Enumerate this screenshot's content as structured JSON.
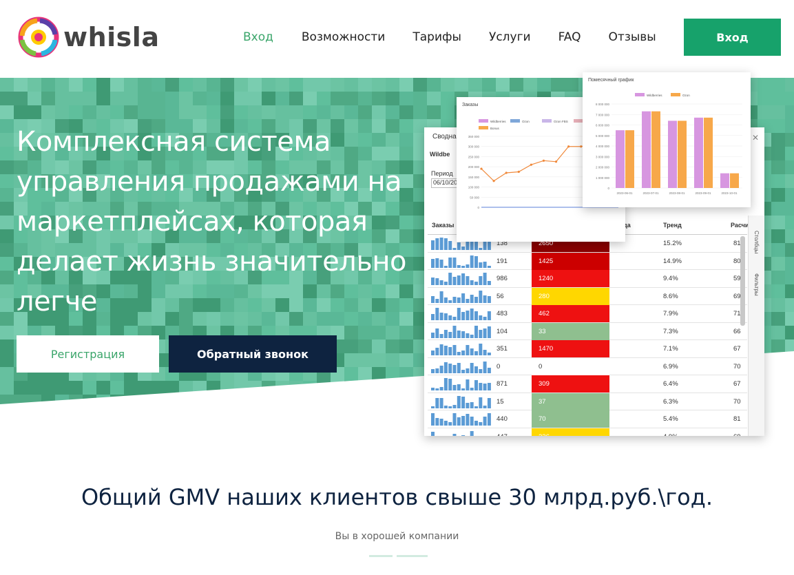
{
  "brand": {
    "name": "whisla",
    "accent": "#17a26b",
    "dark": "#0e2340"
  },
  "nav": {
    "items": [
      {
        "label": "Вход",
        "active": true
      },
      {
        "label": "Возможности"
      },
      {
        "label": "Тарифы"
      },
      {
        "label": "Услуги"
      },
      {
        "label": "FAQ"
      },
      {
        "label": "Отзывы"
      }
    ],
    "login_button": "Вход"
  },
  "hero": {
    "title": "Комплексная система управления продажами на маркетплейсах, которая делает жизнь значительно легче",
    "register_button": "Регистрация",
    "callback_button": "Обратный звонок"
  },
  "mockup": {
    "window_title": "Сводна",
    "tab": "Wildbe",
    "period_label": "Период",
    "period_value": "06/10/202",
    "columns": {
      "orders": "Заказы",
      "trend": "Тренд",
      "calc": "Расчита",
      "partial": "да"
    },
    "side_labels": {
      "columns": "Столбцы",
      "filters": "Фильтры"
    },
    "rows": [
      {
        "orders": "138",
        "heat": "2650",
        "heat_color": "#8b0000",
        "trend": "15.2%",
        "calc": "81"
      },
      {
        "orders": "191",
        "heat": "1425",
        "heat_color": "#cc0000",
        "trend": "14.9%",
        "calc": "80"
      },
      {
        "orders": "986",
        "heat": "1240",
        "heat_color": "#ee1111",
        "trend": "9.4%",
        "calc": "59"
      },
      {
        "orders": "56",
        "heat": "280",
        "heat_color": "#ffd700",
        "trend": "8.6%",
        "calc": "69"
      },
      {
        "orders": "483",
        "heat": "462",
        "heat_color": "#ee1111",
        "trend": "7.9%",
        "calc": "71"
      },
      {
        "orders": "104",
        "heat": "33",
        "heat_color": "#8fbf8f",
        "trend": "7.3%",
        "calc": "66"
      },
      {
        "orders": "351",
        "heat": "1470",
        "heat_color": "#ee1111",
        "trend": "7.1%",
        "calc": "67"
      },
      {
        "orders": "0",
        "heat": "0",
        "heat_color": "#ffffff",
        "trend": "6.9%",
        "calc": "70"
      },
      {
        "orders": "871",
        "heat": "309",
        "heat_color": "#ee1111",
        "trend": "6.4%",
        "calc": "67"
      },
      {
        "orders": "15",
        "heat": "37",
        "heat_color": "#8fbf8f",
        "trend": "6.3%",
        "calc": "70"
      },
      {
        "orders": "440",
        "heat": "70",
        "heat_color": "#8fbf8f",
        "trend": "5.4%",
        "calc": "81"
      },
      {
        "orders": "447",
        "heat": "226",
        "heat_color": "#ffd700",
        "trend": "4.9%",
        "calc": "69"
      }
    ],
    "line_chart": {
      "title": "Заказы",
      "legend": [
        "Wildberries",
        "Ozon",
        "Ozon FBS",
        "Yandex / SB",
        "Bonus"
      ],
      "y_ticks": [
        "350 000",
        "300 000",
        "250 000",
        "200 000",
        "150 000",
        "100 000",
        "50 000",
        "0"
      ],
      "values": [
        190000,
        130000,
        170000,
        175000,
        210000,
        230000,
        225000,
        300000,
        300000,
        310000,
        260000,
        230000
      ]
    },
    "bar_chart": {
      "title": "Помесячный график",
      "legend": [
        "Wildberries",
        "Ozon"
      ],
      "y_ticks": [
        "8 000 000",
        "7 000 000",
        "6 000 000",
        "5 000 000",
        "4 000 000",
        "3 000 000",
        "2 000 000",
        "1 000 000",
        "0"
      ],
      "x_labels": [
        "2023-06-01",
        "2023-07-01",
        "2023-08-01",
        "2023-09-01",
        "2023-10-01"
      ],
      "series_a": [
        5500000,
        7300000,
        6400000,
        6700000,
        1400000
      ],
      "series_b": [
        5500000,
        7300000,
        6400000,
        6700000,
        1400000
      ],
      "colors": [
        "#d796e0",
        "#f7a84a"
      ]
    }
  },
  "stats": {
    "gmv_title": "Общий GMV наших клиентов свыше 30 млрд.руб.\\год.",
    "company_caption": "Вы в хорошей компании"
  }
}
